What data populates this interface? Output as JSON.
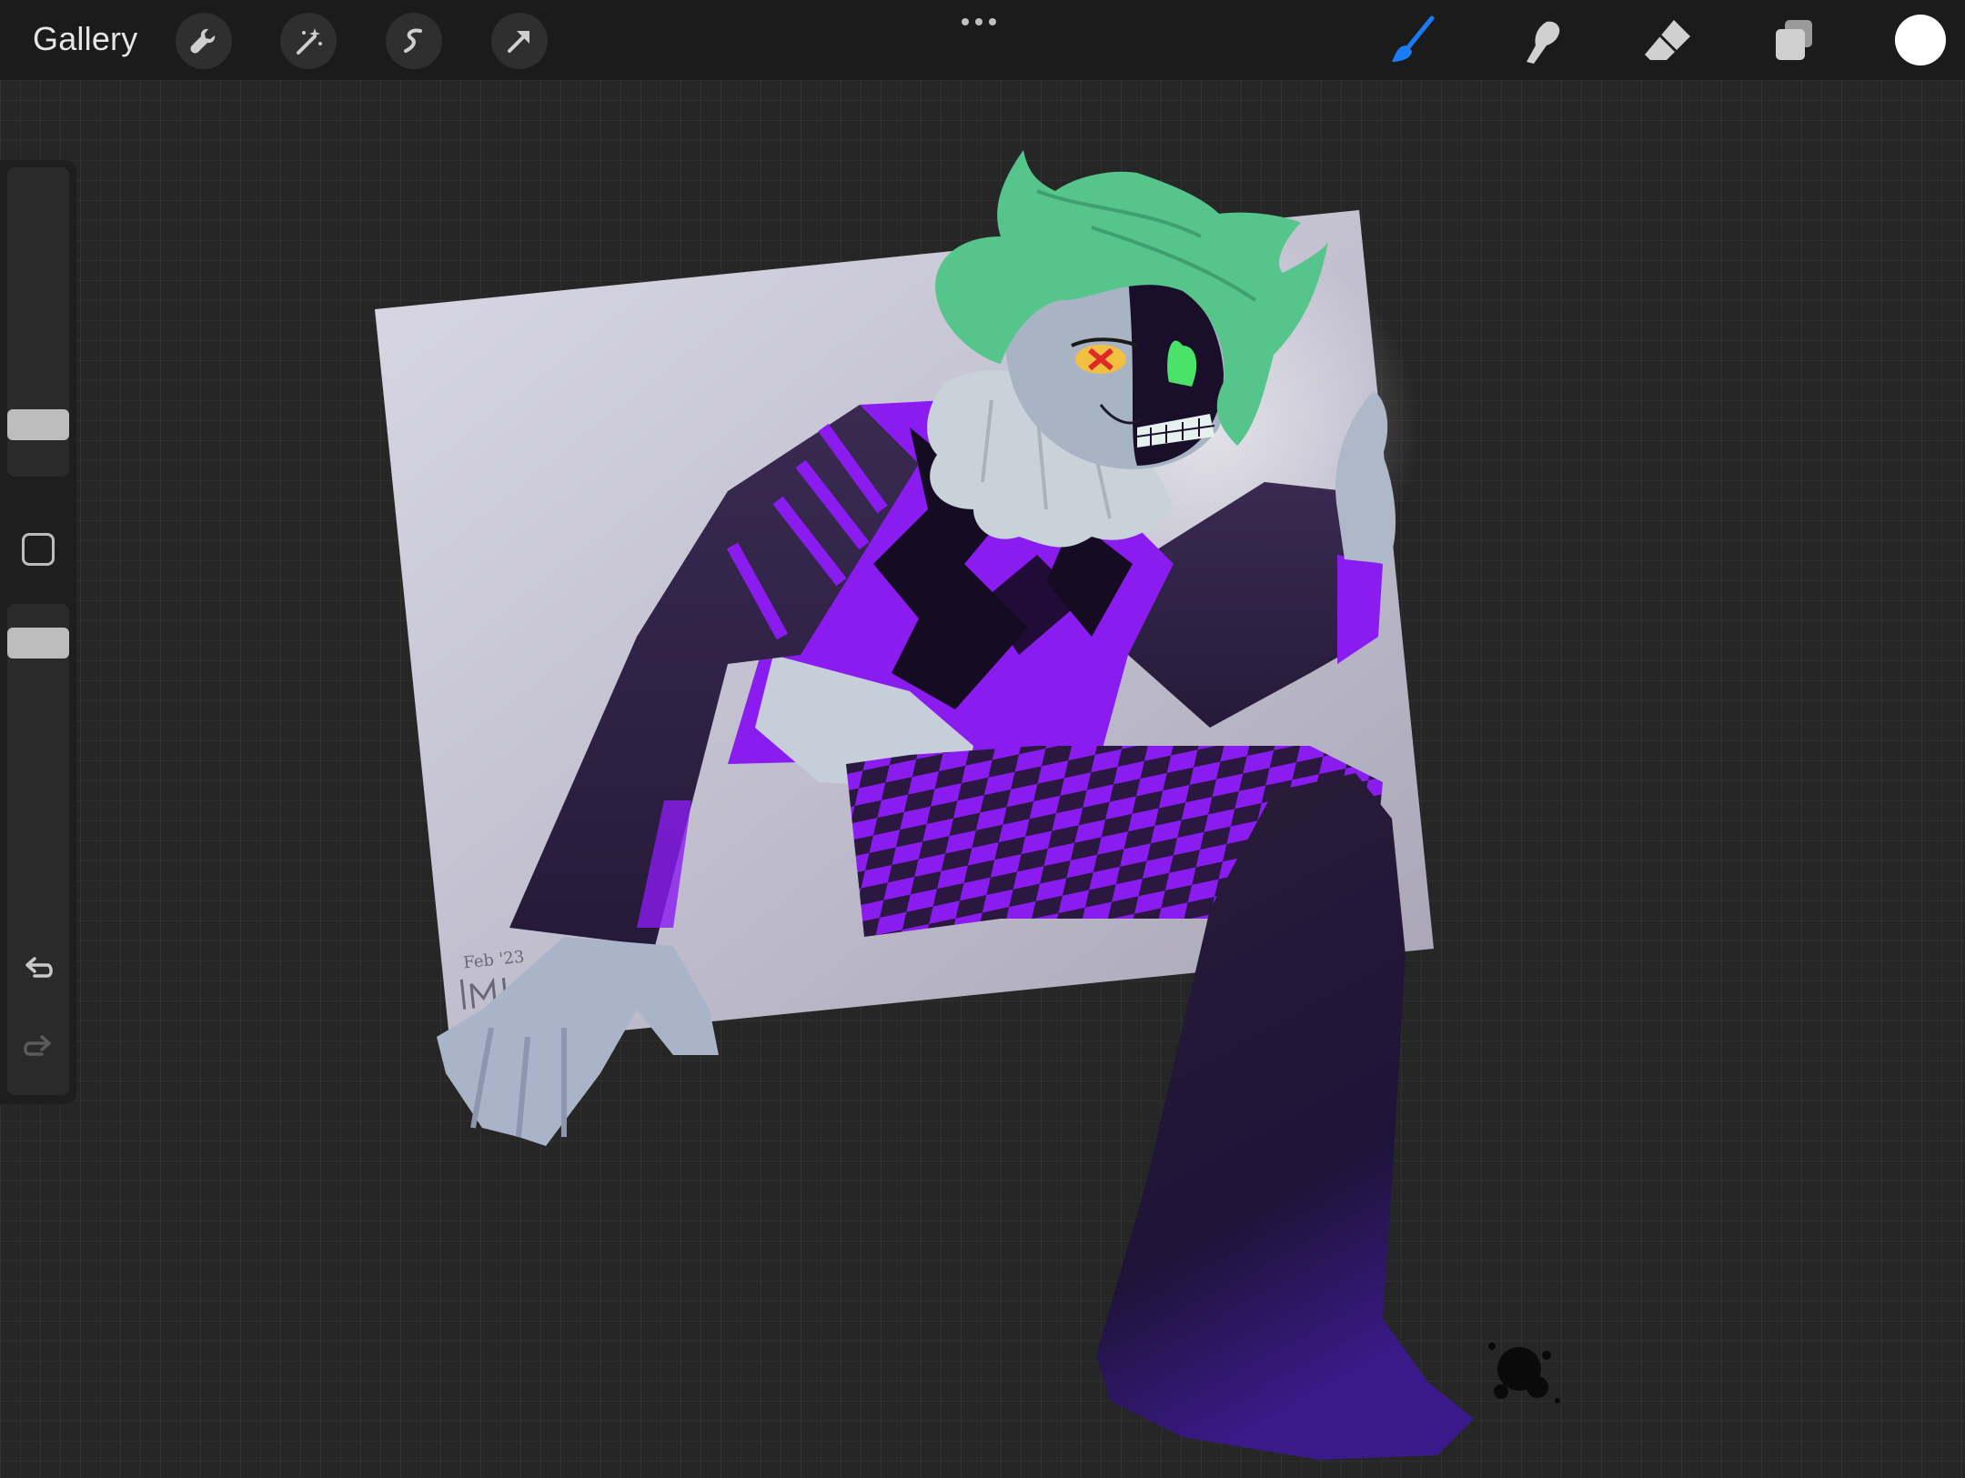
{
  "toolbar": {
    "gallery_label": "Gallery",
    "left_tools": [
      "actions-icon",
      "adjustments-icon",
      "selection-icon",
      "transform-icon"
    ],
    "right_tools": [
      "brush-icon",
      "smudge-icon",
      "eraser-icon",
      "layers-icon"
    ],
    "active_tool": "brush",
    "accent_color": "#1a7cf5",
    "current_color": "#ffffff"
  },
  "sidebar": {
    "brush_size": 0.2,
    "opacity": 0.95
  },
  "canvas": {
    "signature_text": "Feb '23",
    "colors": {
      "hair": "#55c58b",
      "skin": "#aab6c8",
      "purple": "#8e1ff2",
      "dark_purple": "#2a1840",
      "background_card": "#c9c8d6"
    }
  }
}
